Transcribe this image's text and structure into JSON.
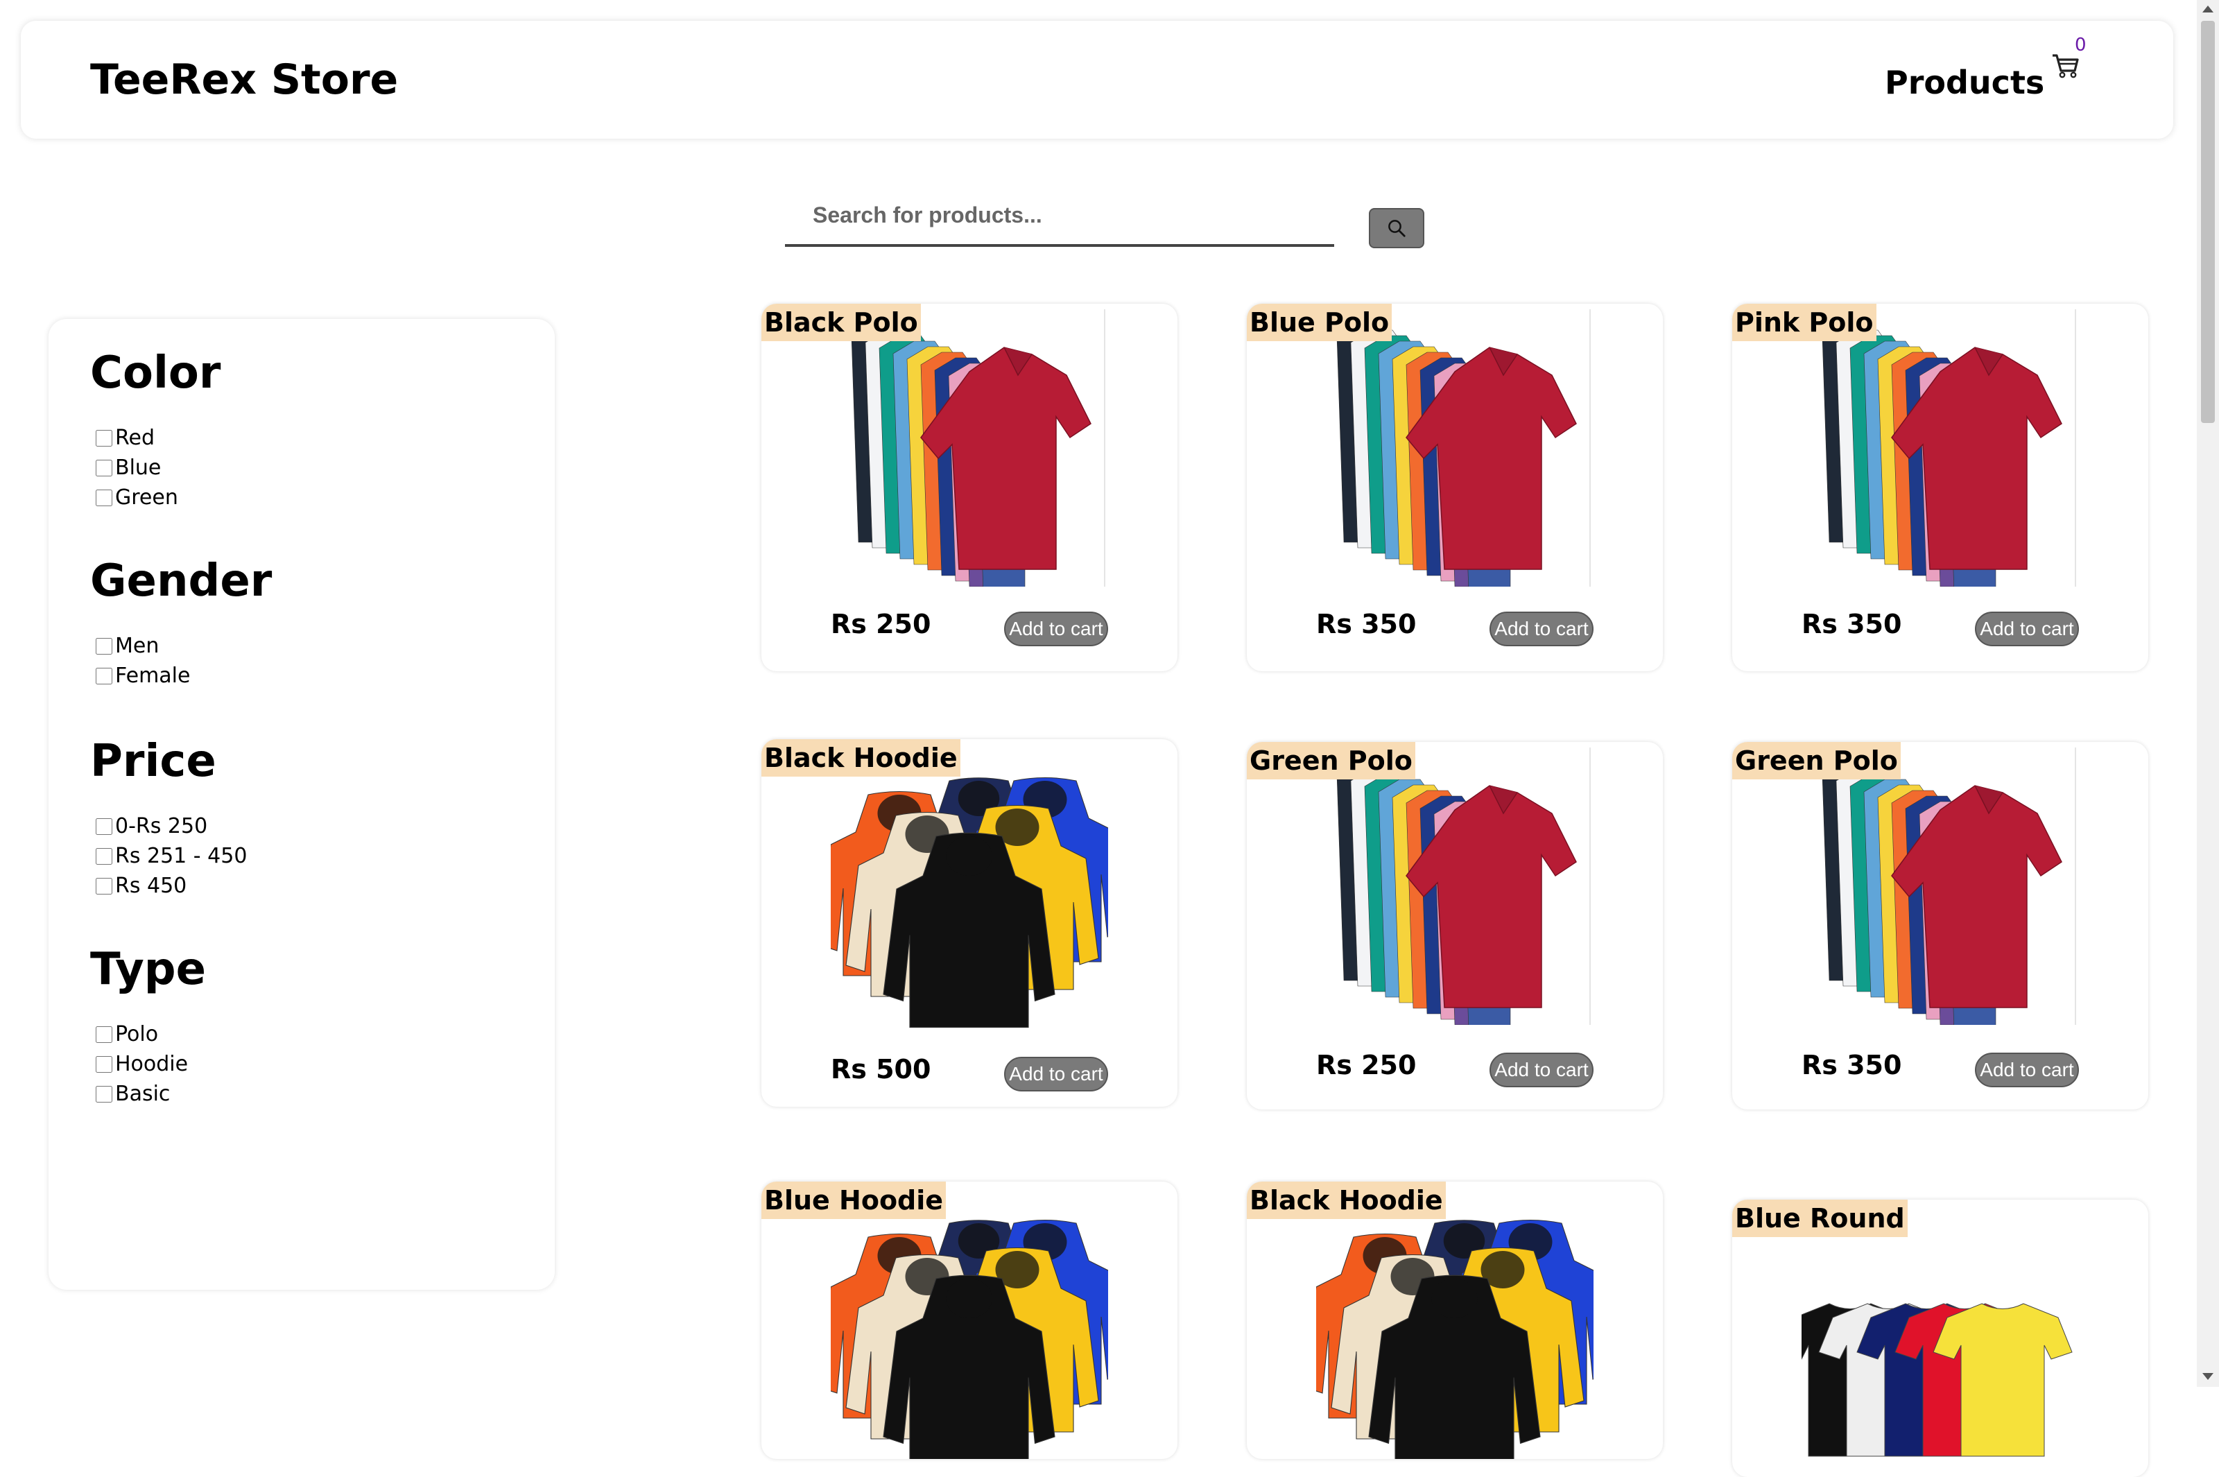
{
  "header": {
    "brand": "TeeRex Store",
    "nav_products": "Products",
    "cart_count": "0"
  },
  "search": {
    "placeholder": "Search for products..."
  },
  "filters": [
    {
      "title": "Color",
      "options": [
        "Red",
        "Blue",
        "Green"
      ]
    },
    {
      "title": "Gender",
      "options": [
        "Men",
        "Female"
      ]
    },
    {
      "title": "Price",
      "options": [
        "0-Rs 250",
        "Rs 251 - 450",
        "Rs 450"
      ]
    },
    {
      "title": "Type",
      "options": [
        "Polo",
        "Hoodie",
        "Basic"
      ]
    }
  ],
  "add_to_cart_label": "Add to cart",
  "products": [
    {
      "name": "Black Polo",
      "price": "Rs 250",
      "type": "polo"
    },
    {
      "name": "Blue Polo",
      "price": "Rs 350",
      "type": "polo"
    },
    {
      "name": "Pink Polo",
      "price": "Rs 350",
      "type": "polo"
    },
    {
      "name": "Black Hoodie",
      "price": "Rs 500",
      "type": "hoodie"
    },
    {
      "name": "Green Polo",
      "price": "Rs 250",
      "type": "polo"
    },
    {
      "name": "Green Polo",
      "price": "Rs 350",
      "type": "polo"
    },
    {
      "name": "Blue Hoodie",
      "price": "",
      "type": "hoodie"
    },
    {
      "name": "Black Hoodie",
      "price": "",
      "type": "hoodie"
    },
    {
      "name": "Blue Round",
      "price": "",
      "type": "round"
    }
  ],
  "colors": {
    "title_highlight": "#f8dcb5",
    "button_grey": "#7a7a7a",
    "cart_count": "#6a1aa8"
  }
}
